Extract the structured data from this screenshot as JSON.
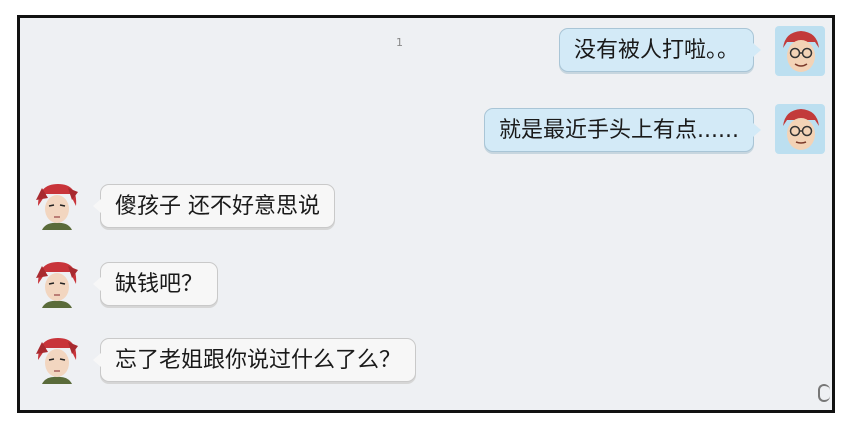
{
  "chat": {
    "marker": "1",
    "messages": [
      {
        "side": "right",
        "text": "没有被人打啦。。",
        "avatar": "glasses-man-avatar"
      },
      {
        "side": "right",
        "text": "就是最近手头上有点......",
        "avatar": "glasses-man-avatar"
      },
      {
        "side": "left",
        "text": "傻孩子 还不好意思说",
        "avatar": "red-hair-woman-avatar"
      },
      {
        "side": "left",
        "text": "缺钱吧？",
        "avatar": "red-hair-woman-avatar"
      },
      {
        "side": "left",
        "text": "忘了老姐跟你说过什么了么？",
        "avatar": "red-hair-woman-avatar"
      }
    ]
  },
  "colors": {
    "background": "#eef0f3",
    "right_bubble": "#d3eaf7",
    "left_bubble": "#f7f7f7",
    "frame_border": "#111111"
  }
}
